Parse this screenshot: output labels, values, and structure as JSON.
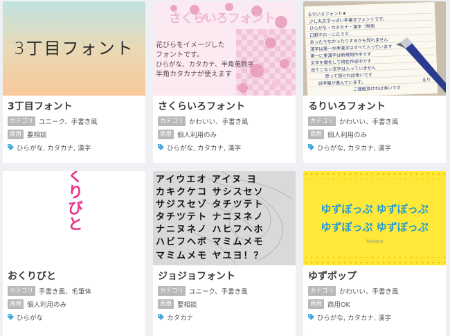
{
  "colors": {
    "badge": "#b9b9b9",
    "tag_icon": "#4aa8d8",
    "title": "#3a3a3a"
  },
  "labels": {
    "category": "カテゴリ",
    "commercial": "商用"
  },
  "cards": [
    {
      "title": "3丁目フォント",
      "preview_text": "3丁目フォント",
      "category": "ユニーク、手書き風",
      "commercial": "要相談",
      "tags": "ひらがな, カタカナ, 漢字"
    },
    {
      "title": "さくらいろフォント",
      "preview_text": "さくらいろフォント",
      "preview_body": [
        "花びらをイメージした",
        "フォントです。",
        "ひらがな、カタカナ、半角英数字",
        "半角カタカナが使えます"
      ],
      "category": "かわいい、手書き風",
      "commercial": "個人利用のみ",
      "tags": "ひらがな, カタカナ, 漢字"
    },
    {
      "title": "るりいろフォント",
      "preview_body": [
        "るりいろフォント★",
        "少し丸文字っぽい手書きフォントです。",
        "ひらがな・カタカナ・漢字（常用",
        "口野ネロ・に乙です...",
        "あったりなかったりするかも知れません",
        "漢字は第一水準漢字はすべて入っています",
        "第一に東漢字は新規制作中です",
        "文字を優先して現在作成中です",
        "出てこない文字は入っていません",
        "思って頂ければ幸いです",
        "試字箋が進んでいます。",
        "ご連絡頂ければ幸いです"
      ],
      "preview_sign": "るり",
      "category": "かわいい、手書き風",
      "commercial": "個人利用のみ",
      "tags": "ひらがな, カタカナ, 漢字"
    },
    {
      "title": "おくりびと",
      "preview_text": "おくりびと",
      "category": "手書き風、毛筆体",
      "commercial": "個人利用のみ",
      "tags": "ひらがな"
    },
    {
      "title": "ジョジョフォント",
      "preview_rows": [
        "アイウエオ アイヌ ヨ",
        "カキクケコ サシスセソ",
        "サジスセゾ タチツテト",
        "タチツテト ナニヌネノ",
        "ナニヌネノ ハヒフヘホ",
        "ハビフヘボ マミムメモ",
        "マミムメモ ヤユヨ！？"
      ],
      "category": "ユニーク、手書き風",
      "commercial": "要相談",
      "tags": "カタカナ"
    },
    {
      "title": "ゆずポップ",
      "preview_lines": [
        "ゆずぽっぷ ゆずぽっぷ",
        "ゆずぽっぷ ゆずぽっぷ"
      ],
      "preview_small": "Yuzupop",
      "category": "かわいい、手書き風",
      "commercial": "商用OK",
      "tags": "ひらがな, カタカナ, 漢字"
    }
  ]
}
